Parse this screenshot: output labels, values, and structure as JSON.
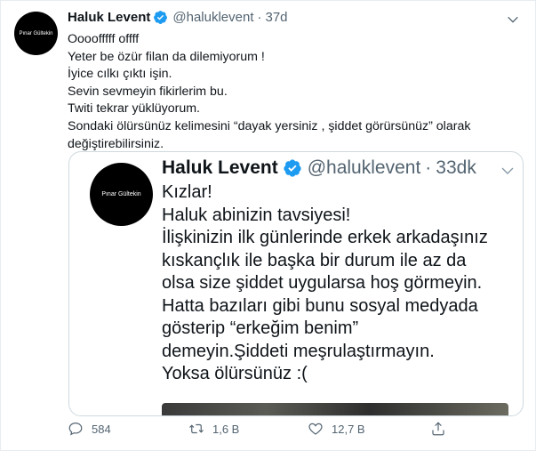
{
  "tweet": {
    "avatar_text": "Pınar Gültekin",
    "name": "Haluk Levent",
    "handle": "@haluklevent",
    "dot": "·",
    "time": "37d",
    "lines": [
      "Oooofffff offff",
      "Yeter be özür filan da dilemiyorum !",
      "İyice cılkı çıktı işin.",
      "Sevin sevmeyin fikirlerim bu.",
      "Twiti tekrar yüklüyorum.",
      "Sondaki ölürsünüz kelimesini “dayak yersiniz , şiddet görürsünüz” olarak",
      "değiştirebilirsiniz."
    ]
  },
  "quoted": {
    "avatar_text": "Pınar Gültekin",
    "name": "Haluk Levent",
    "handle": "@haluklevent",
    "dot": "·",
    "time": "33dk",
    "lines": [
      "Kızlar!",
      "Haluk abinizin tavsiyesi!",
      "İlişkinizin ilk günlerinde erkek arkadaşınız",
      "kıskançlık ile başka bir durum ile az da",
      "olsa size şiddet uygularsa hoş görmeyin.",
      "Hatta bazıları gibi bunu sosyal medyada",
      "gösterip “erkeğim benim”",
      "demeyin.Şiddeti meşrulaştırmayın.",
      "Yoksa ölürsünüz :("
    ]
  },
  "actions": {
    "reply_count": "584",
    "retweet_count": "1,6 B",
    "like_count": "12,7 B"
  },
  "colors": {
    "verified": "#1d9bf0",
    "secondary_text": "#536471"
  },
  "icons": [
    "verified-icon",
    "chevron-down-icon",
    "reply-icon",
    "retweet-icon",
    "like-icon",
    "share-icon"
  ]
}
